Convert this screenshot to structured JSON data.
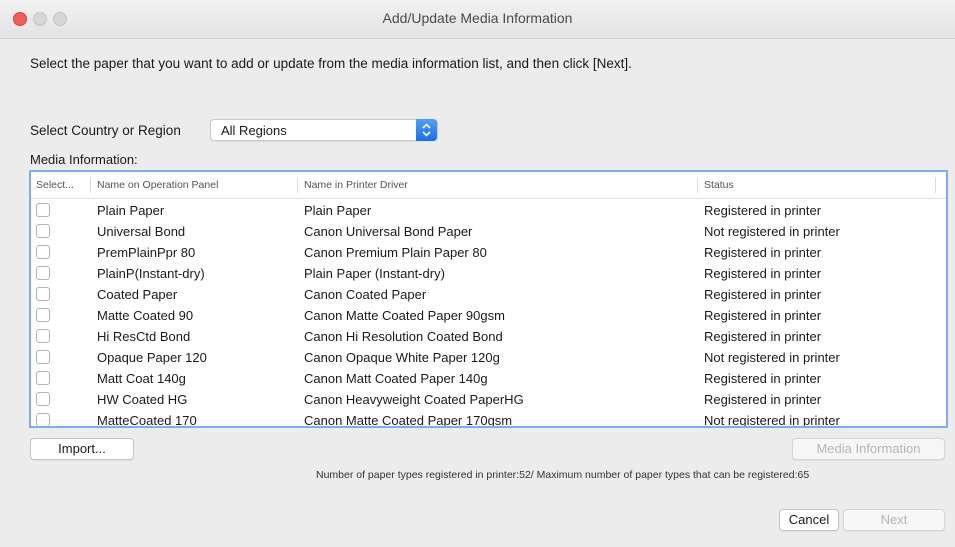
{
  "window": {
    "title": "Add/Update Media Information"
  },
  "instruction": "Select the paper that you want to add or update from the media information list, and then click [Next].",
  "region": {
    "label": "Select Country or Region",
    "selected": "All Regions"
  },
  "media_label": "Media Information:",
  "table": {
    "headers": [
      "Select...",
      "Name on Operation Panel",
      "Name in Printer Driver",
      "Status"
    ],
    "rows": [
      {
        "checked": false,
        "panel": "Plain Paper",
        "driver": "Plain Paper",
        "status": "Registered in printer"
      },
      {
        "checked": false,
        "panel": "Universal Bond",
        "driver": "Canon Universal Bond Paper",
        "status": "Not registered in printer"
      },
      {
        "checked": false,
        "panel": "PremPlainPpr 80",
        "driver": "Canon Premium Plain Paper 80",
        "status": "Registered in printer"
      },
      {
        "checked": false,
        "panel": "PlainP(Instant-dry)",
        "driver": "Plain Paper (Instant-dry)",
        "status": "Registered in printer"
      },
      {
        "checked": false,
        "panel": "Coated Paper",
        "driver": "Canon Coated Paper",
        "status": "Registered in printer"
      },
      {
        "checked": false,
        "panel": "Matte Coated 90",
        "driver": "Canon Matte Coated Paper 90gsm",
        "status": "Registered in printer"
      },
      {
        "checked": false,
        "panel": "Hi ResCtd Bond",
        "driver": "Canon Hi Resolution Coated Bond",
        "status": "Registered in printer"
      },
      {
        "checked": false,
        "panel": "Opaque Paper 120",
        "driver": "Canon Opaque White Paper 120g",
        "status": "Not registered in printer"
      },
      {
        "checked": false,
        "panel": "Matt Coat 140g",
        "driver": "Canon Matt Coated Paper 140g",
        "status": "Registered in printer"
      },
      {
        "checked": false,
        "panel": "HW Coated HG",
        "driver": "Canon Heavyweight Coated PaperHG",
        "status": "Registered in printer"
      },
      {
        "checked": false,
        "panel": "MatteCoated 170",
        "driver": "Canon Matte Coated Paper 170gsm",
        "status": "Not registered in printer"
      }
    ]
  },
  "buttons": {
    "import": "Import...",
    "media_information": "Media Information",
    "cancel": "Cancel",
    "next": "Next"
  },
  "footnote": "Number of paper types registered in printer:52/ Maximum number of paper types that can be registered:65"
}
